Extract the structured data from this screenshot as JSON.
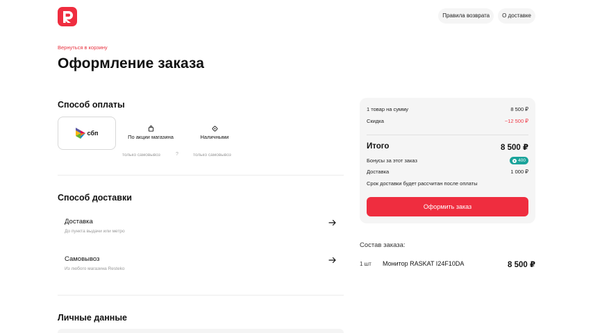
{
  "header": {
    "logo_letter": "R",
    "links": [
      "Правила возврата",
      "О доставке"
    ]
  },
  "back_link": "Вернуться в корзину",
  "page_title": "Оформление заказа",
  "payment": {
    "title": "Способ оплаты",
    "options": [
      {
        "label": "сбп",
        "icon": "sbp-logo",
        "note": ""
      },
      {
        "label": "По акции магазина",
        "icon": "shopping-bag-icon",
        "note": "только самовывоз"
      },
      {
        "label": "Наличными",
        "icon": "cash-tag-icon",
        "note": "только самовывоз"
      }
    ],
    "help_mark": "?"
  },
  "delivery": {
    "title": "Способ доставки",
    "options": [
      {
        "name": "Доставка",
        "desc": "До пункта выдачи или метро"
      },
      {
        "name": "Самовывоз",
        "desc": "Из любого магазина Resteko"
      }
    ]
  },
  "personal": {
    "title": "Личные данные"
  },
  "summary": {
    "items_label": "1 товар на сумму",
    "items_value": "8 500 ₽",
    "discount_label": "Скидка",
    "discount_value": "−12 500 ₽",
    "total_label": "Итого",
    "total_value": "8 500 ₽",
    "bonus_label": "Бонусы за этот заказ",
    "bonus_value": "400",
    "delivery_label": "Доставка",
    "delivery_value": "1 000 ₽",
    "delivery_note": "Срок доставки будет рассчитан после оплаты",
    "order_button": "Оформить заказ"
  },
  "composition": {
    "title": "Состав заказа:",
    "items": [
      {
        "qty": "1 шт",
        "name": "Монитор RASKAT I24F10DA",
        "price": "8 500 ₽"
      }
    ]
  },
  "colors": {
    "accent": "#ef2d3f",
    "bonus": "#1aa39a",
    "muted": "#9a9a9a"
  }
}
